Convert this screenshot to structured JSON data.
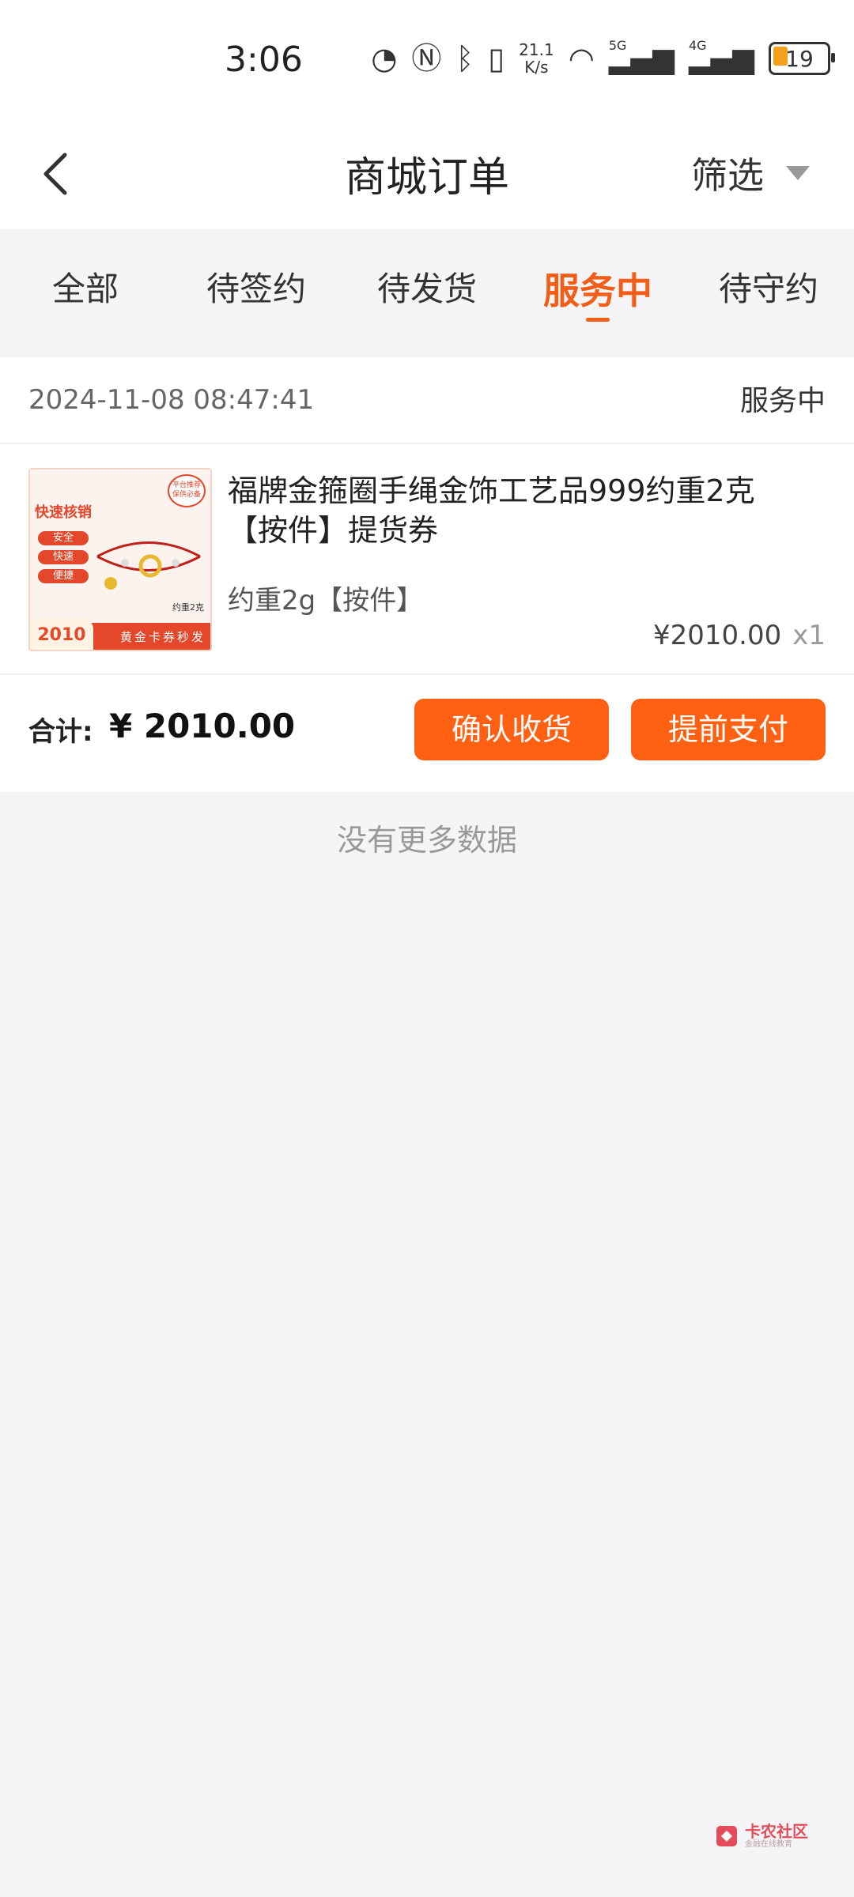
{
  "status_bar": {
    "time": "3:06",
    "net_speed_value": "21.1",
    "net_speed_unit": "K/s",
    "network_5g": "5G",
    "network_4g": "4G",
    "battery": "19"
  },
  "header": {
    "title": "商城订单",
    "filter_label": "筛选"
  },
  "tabs": [
    {
      "label": "全部"
    },
    {
      "label": "待签约"
    },
    {
      "label": "待发货"
    },
    {
      "label": "服务中",
      "active": true
    },
    {
      "label": "待守约"
    }
  ],
  "order": {
    "datetime": "2024-11-08 08:47:41",
    "status": "服务中",
    "product": {
      "image_badge_title": "快速核销",
      "image_pills": [
        "安全",
        "快速",
        "便捷"
      ],
      "image_tag": "平台推荐 保供必备",
      "image_price": "2010",
      "image_banner": "黄金卡券秒发",
      "image_weight": "约重2克",
      "name": "福牌金箍圈手绳金饰工艺品999约重2克【按件】提货券",
      "spec": "约重2g【按件】",
      "price": "¥2010.00",
      "quantity": "x1"
    },
    "total_label": "合计:",
    "total_value": "¥ 2010.00",
    "buttons": {
      "confirm": "确认收货",
      "prepay": "提前支付"
    }
  },
  "footer_text": "没有更多数据",
  "watermark": {
    "main": "卡农社区",
    "sub": "金融在线教育"
  },
  "colors": {
    "accent": "#f25d17",
    "button": "#ff6011",
    "background": "#f5f5f7"
  }
}
